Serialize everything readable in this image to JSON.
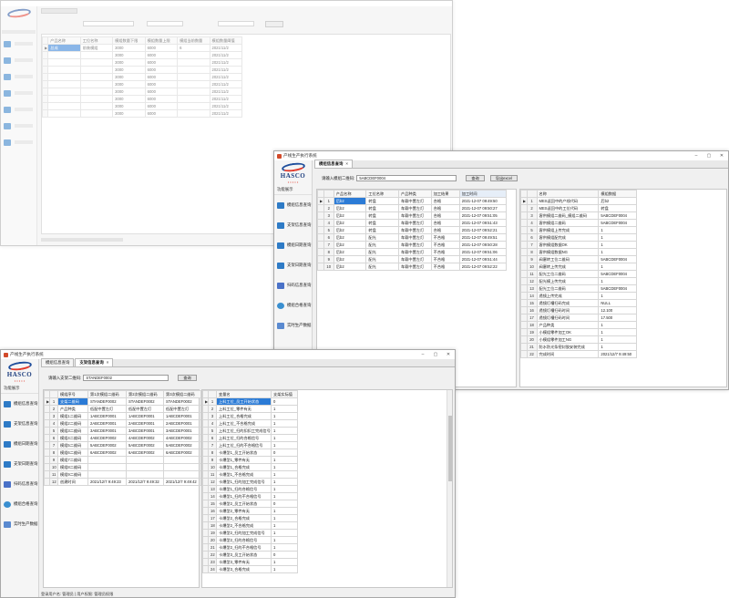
{
  "back_window": {
    "header_cells": [
      "产品名称",
      "工位名称",
      "模组数量下限",
      "模组数量上限",
      "模组当前数量",
      "模组数量阈值"
    ],
    "rows": [
      [
        "总成",
        "前装模组",
        "3000",
        "6000",
        "6",
        "2021/11/2"
      ],
      [
        "",
        "",
        "3000",
        "6000",
        "",
        "2021/11/2"
      ],
      [
        "",
        "",
        "3000",
        "6000",
        "",
        "2021/11/2"
      ],
      [
        "",
        "",
        "3000",
        "6000",
        "",
        "2021/11/2"
      ],
      [
        "",
        "",
        "3000",
        "6000",
        "",
        "2021/11/2"
      ],
      [
        "",
        "",
        "3000",
        "6000",
        "",
        "2021/11/2"
      ],
      [
        "",
        "",
        "3000",
        "6000",
        "",
        "2021/11/2"
      ],
      [
        "",
        "",
        "3000",
        "6000",
        "",
        "2021/11/2"
      ],
      [
        "",
        "",
        "3000",
        "6000",
        "",
        "2021/11/2"
      ],
      [
        "",
        "",
        "3000",
        "6000",
        "",
        "2021/11/2"
      ]
    ]
  },
  "mid_window": {
    "title": "产线生产执行系统",
    "tab": "模组信息查询",
    "logo": "HASCO",
    "menu_head": "功能展示",
    "menu": [
      "模组信息查询",
      "支架信息查询",
      "模组日期查询",
      "支架日期查询",
      "扫码信息查询",
      "模组合格查询",
      "实时生产数据"
    ],
    "input_label": "请输入模组二维码:",
    "input_value": "5ABCDEF0004",
    "query_btn": "查询",
    "export_btn": "导出excel",
    "left_headers": [
      "产品名称",
      "工位名称",
      "产品种类",
      "加工结果",
      "加工时间"
    ],
    "left_rows": [
      [
        "后b2",
        "转盘",
        "车载中置左灯",
        "合格",
        "2021-12-07 09:49:50"
      ],
      [
        "后b2",
        "转盘",
        "车载中置左灯",
        "合格",
        "2021-12-07 09:50:27"
      ],
      [
        "后b2",
        "转盘",
        "车载中置左灯",
        "合格",
        "2021-12-07 09:51:05"
      ],
      [
        "后b2",
        "转盘",
        "车载中置左灯",
        "合格",
        "2021-12-07 09:51:43"
      ],
      [
        "后b2",
        "转盘",
        "车载中置左灯",
        "合格",
        "2021-12-07 09:52:21"
      ],
      [
        "后b2",
        "配光",
        "车载中置左灯",
        "不合格",
        "2021-12-07 09:49:51"
      ],
      [
        "后b2",
        "配光",
        "车载中置左灯",
        "不合格",
        "2021-12-07 09:50:28"
      ],
      [
        "后b2",
        "配光",
        "车载中置左灯",
        "不合格",
        "2021-12-07 09:51:06"
      ],
      [
        "后b2",
        "配光",
        "车载中置左灯",
        "不合格",
        "2021-12-07 09:51:44"
      ],
      [
        "后b2",
        "配光",
        "车载中置左灯",
        "不合格",
        "2021-12-07 09:52:22"
      ]
    ],
    "right_headers": [
      "名称",
      "模组数据"
    ],
    "right_rows": [
      [
        "MES返回中的产线代码",
        "后b2"
      ],
      [
        "MES返回中的工位代码",
        "转盘"
      ],
      [
        "客供模组二维码_模组二维码",
        "5ABCDEF0004"
      ],
      [
        "客供模组二维码",
        "5ABCDEF0004"
      ],
      [
        "客供模组上传完成",
        "1"
      ],
      [
        "客供模组配完成",
        "1"
      ],
      [
        "客供模组数据OK",
        "1"
      ],
      [
        "客供模组数据NG",
        "1"
      ],
      [
        "阀塞转工位二维码",
        "5ABCDEF0004"
      ],
      [
        "阀塞转上传完成",
        "1"
      ],
      [
        "配光工位二维码",
        "5ABCDEF0004"
      ],
      [
        "配光模上传完成",
        "1"
      ],
      [
        "配光工位二维码",
        "5ABCDEF0004"
      ],
      [
        "透镜上传完成",
        "1"
      ],
      [
        "透镜灯槽扫码完成",
        "NULL"
      ],
      [
        "透镜灯槽扫码时间",
        "12.100"
      ],
      [
        "透镜灯槽扫码时间",
        "17.500"
      ],
      [
        "产品种类",
        "1"
      ],
      [
        "小模组零件加工OK",
        "1"
      ],
      [
        "小模组零件加工NG",
        "1"
      ],
      [
        "防水防光条密封胶安装完成",
        "1"
      ],
      [
        "完成时间",
        "2021/12/7 9:49:50"
      ]
    ]
  },
  "front_window": {
    "title": "产线生产执行系统",
    "tabs": [
      "模组信息查询",
      "支架信息查询"
    ],
    "logo": "HASCO",
    "menu_head": "功能展示",
    "menu": [
      "模组信息查询",
      "支架信息查询",
      "模组日期查询",
      "支架日期查询",
      "扫码信息查询",
      "模组合格查询",
      "实时生产数据"
    ],
    "input_label": "请输入支架二维码:",
    "input_value": "STANDEF0002",
    "query_btn": "查询",
    "left_headers": [
      "模组序号",
      "第1次模组二维码",
      "第2次模组二维码",
      "第3次模组二维码"
    ],
    "left_rows": [
      [
        "支架二维码",
        "STANDEF0002",
        "STANDEF0002",
        "STANDEF0002"
      ],
      [
        "产品种类",
        "低配中置左灯",
        "低配中置左灯",
        "低配中置左灯"
      ],
      [
        "模组1二维码",
        "1ABCDEF0001",
        "1ABCDEF0001",
        "1ABCDEF0001"
      ],
      [
        "模组2二维码",
        "2ABCDEF0001",
        "2ABCDEF0001",
        "2ABCDEF0001"
      ],
      [
        "模组3二维码",
        "3ABCDEF0001",
        "3ABCDEF0001",
        "3ABCDEF0001"
      ],
      [
        "模组4二维码",
        "4ABCDEF0002",
        "4ABCDEF0002",
        "4ABCDEF0002"
      ],
      [
        "模组5二维码",
        "5ABCDEF0002",
        "5ABCDEF0002",
        "5ABCDEF0002"
      ],
      [
        "模组6二维码",
        "6ABCDEF0002",
        "6ABCDEF0002",
        "6ABCDEF0002"
      ],
      [
        "模组7二维码",
        "",
        "",
        ""
      ],
      [
        "模组8二维码",
        "",
        "",
        ""
      ],
      [
        "模组9二维码",
        "",
        "",
        ""
      ],
      [
        "创建时间",
        "2021/12/7 9:49:23",
        "2021/12/7 9:49:32",
        "2021/12/7 9:49:42"
      ]
    ],
    "right_headers": [
      "变量名",
      "支架实际值"
    ],
    "right_rows": [
      [
        "上料工位_员工开始状态",
        "0"
      ],
      [
        "上料工位_零件有无",
        "1"
      ],
      [
        "上料工位_合格完成",
        "1"
      ],
      [
        "上料工位_不合格完成",
        "1"
      ],
      [
        "上料工位_扫的扣扣工完成信号",
        "1"
      ],
      [
        "上料工位_扫的合格信号",
        "1"
      ],
      [
        "上料工位_扫的不合格信号",
        "1"
      ],
      [
        "卡爆型1_员工开始状态",
        "0"
      ],
      [
        "卡爆型1_零件有无",
        "1"
      ],
      [
        "卡爆型1_合格完成",
        "1"
      ],
      [
        "卡爆型1_不合格完成",
        "1"
      ],
      [
        "卡爆型1_扫的加工完成信号",
        "1"
      ],
      [
        "卡爆型1_扫的合格信号",
        "1"
      ],
      [
        "卡爆型1_扫的不合格信号",
        "1"
      ],
      [
        "卡爆型2_员工开始状态",
        "0"
      ],
      [
        "卡爆型2_零件有无",
        "1"
      ],
      [
        "卡爆型2_合格完成",
        "1"
      ],
      [
        "卡爆型2_不合格完成",
        "1"
      ],
      [
        "卡爆型2_扫的加工完成信号",
        "1"
      ],
      [
        "卡爆型2_扫的合格信号",
        "1"
      ],
      [
        "卡爆型2_扫的不合格信号",
        "1"
      ],
      [
        "卡爆型3_员工开始状态",
        "0"
      ],
      [
        "卡爆型3_零件有无",
        "1"
      ],
      [
        "卡爆型3_合格完成",
        "1"
      ]
    ],
    "status": "登录用户名: 管理员  |  用户权限: 管理员权限"
  }
}
